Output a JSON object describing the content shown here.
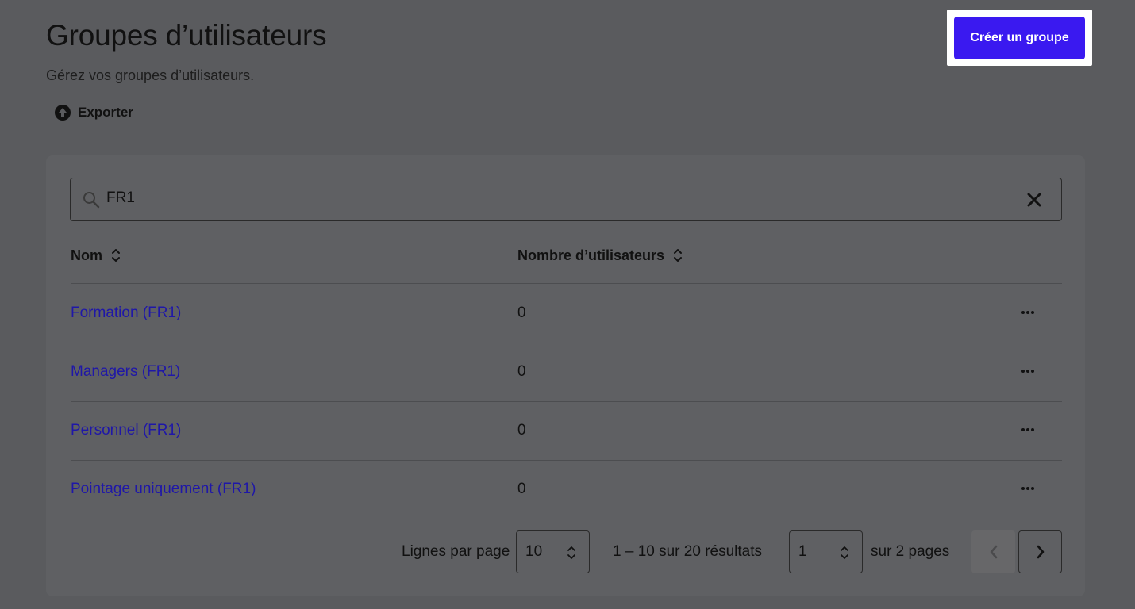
{
  "header": {
    "title": "Groupes d’utilisateurs",
    "subtitle": "Gérez vos groupes d’utilisateurs.",
    "export_label": "Exporter",
    "create_button": "Créer un groupe"
  },
  "search": {
    "value": "FR1",
    "icon": "search-icon"
  },
  "table": {
    "columns": [
      "Nom",
      "Nombre d’utilisateurs"
    ],
    "rows": [
      {
        "name": "Formation (FR1)",
        "count": "0"
      },
      {
        "name": "Managers (FR1)",
        "count": "0"
      },
      {
        "name": "Personnel (FR1)",
        "count": "0"
      },
      {
        "name": "Pointage uniquement (FR1)",
        "count": "0"
      }
    ]
  },
  "pagination": {
    "rows_per_page_label": "Lignes par page",
    "rows_per_page": "10",
    "range_text": "1 – 10 sur 20 résultats",
    "current_page": "1",
    "total_pages_text": "sur 2 pages"
  },
  "colors": {
    "accent": "#3a19f0",
    "link": "#1f17a8",
    "overlay_background": "#5a5b5e"
  }
}
